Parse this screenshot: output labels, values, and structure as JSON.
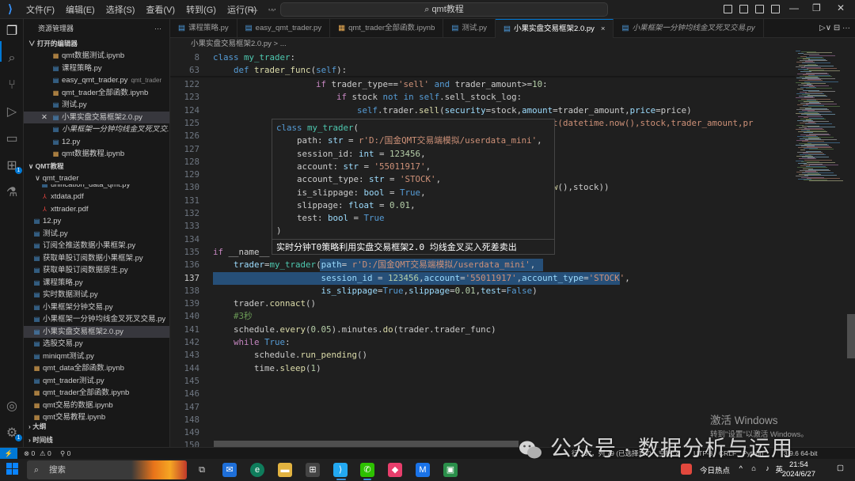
{
  "app": {
    "title": "qmt教程",
    "menu": [
      "文件(F)",
      "编辑(E)",
      "选择(S)",
      "查看(V)",
      "转到(G)",
      "运行(R)"
    ],
    "more": "···"
  },
  "sidebar": {
    "title": "资源管理器",
    "title_more": "···",
    "open_editors_label": "打开的编辑器",
    "open_editors": [
      {
        "name": "qmt数据测试.ipynb",
        "desc": ""
      },
      {
        "name": "课程策略.py",
        "desc": ""
      },
      {
        "name": "easy_qmt_trader.py",
        "desc": "qmt_trader"
      },
      {
        "name": "qmt_trader全部函数.ipynb",
        "desc": ""
      },
      {
        "name": "测试.py",
        "desc": ""
      },
      {
        "name": "小果实盘交易框架2.0.py",
        "desc": ""
      },
      {
        "name": "小果框架一分钟均线金叉死叉交...",
        "desc": ""
      },
      {
        "name": "12.py",
        "desc": ""
      },
      {
        "name": "qmt数据教程.ipynb",
        "desc": ""
      }
    ],
    "workspace_label": "QMT教程",
    "folder": "qmt_trader",
    "files": [
      "unification_data_qmt.py",
      "xtdata.pdf",
      "xttrader.pdf",
      "12.py",
      "测试.py",
      "订阅全推送数据小果框架.py",
      "获取单股订阅数据小果框架.py",
      "获取单股订阅数据原生.py",
      "课程策略.py",
      "实时数据测试.py",
      "小果框架分钟交易.py",
      "小果框架一分钟均线金叉死叉交易.py",
      "小果实盘交易框架2.0.py",
      "选股交易.py",
      "miniqmt测试.py",
      "qmt_data全部函数.ipynb",
      "qmt_trader测试.py",
      "qmt_trader全部函数.ipynb",
      "qmt交易的数据.ipynb",
      "qmt交易教程.ipynb"
    ],
    "outline_label": "大纲",
    "timeline_label": "时间线"
  },
  "tabs": [
    {
      "label": "课程策略.py",
      "active": false
    },
    {
      "label": "easy_qmt_trader.py",
      "active": false
    },
    {
      "label": "qmt_trader全部函数.ipynb",
      "active": false
    },
    {
      "label": "测试.py",
      "active": false
    },
    {
      "label": "小果实盘交易框架2.0.py",
      "active": true,
      "close": "×"
    },
    {
      "label": "小果框架一分钟均线金叉死叉交易.py",
      "active": false
    }
  ],
  "breadcrumb": "小果实盘交易框架2.0.py > ...",
  "editor": {
    "sticky": [
      {
        "ln": "8",
        "code": "class my_trader:"
      },
      {
        "ln": "63",
        "code": "    def trader_func(self):"
      }
    ],
    "lines": [
      {
        "ln": "122",
        "code": "                    if trader_type=='sell' and trader_amount>=10:"
      },
      {
        "ln": "123",
        "code": "                        if stock not in self.sell_stock_log:"
      },
      {
        "ln": "124",
        "code": "                            self.trader.sell(security=stock,amount=trader_amount,price=price)"
      },
      {
        "ln": "125",
        "code": "                                                           '.format(datetime.now(),stock,trader_amount,pr"
      },
      {
        "ln": "126",
        "code": ""
      },
      {
        "ln": "127",
        "code": ""
      },
      {
        "ln": "128",
        "code": ""
      },
      {
        "ln": "129",
        "code": ""
      },
      {
        "ln": "130",
        "code": "                                                          etime.now(),stock))"
      },
      {
        "ln": "131",
        "code": ""
      },
      {
        "ln": "132",
        "code": "                                                          ,stock))"
      },
      {
        "ln": "133",
        "code": "            els"
      },
      {
        "ln": "134",
        "code": ""
      },
      {
        "ln": "135",
        "code": "if __name__"
      },
      {
        "ln": "136",
        "code": "    trader=my_trader(path= r'D:/国金QMT交易端模拟/userdata_mini',"
      },
      {
        "ln": "137",
        "code": "                     session_id = 123456,account='55011917',account_type='STOCK',"
      },
      {
        "ln": "138",
        "code": "                     is_slippage=True,slippage=0.01,test=False)"
      },
      {
        "ln": "139",
        "code": "    trader.connact()"
      },
      {
        "ln": "140",
        "code": "    #3秒"
      },
      {
        "ln": "141",
        "code": "    schedule.every(0.05).minutes.do(trader.trader_func)"
      },
      {
        "ln": "142",
        "code": "    while True:"
      },
      {
        "ln": "143",
        "code": "        schedule.run_pending()"
      },
      {
        "ln": "144",
        "code": "        time.sleep(1)"
      },
      {
        "ln": "145",
        "code": ""
      },
      {
        "ln": "146",
        "code": ""
      },
      {
        "ln": "147",
        "code": ""
      },
      {
        "ln": "148",
        "code": ""
      },
      {
        "ln": "149",
        "code": ""
      },
      {
        "ln": "150",
        "code": ""
      }
    ]
  },
  "hover": {
    "lines": [
      "class my_trader(",
      "    path: str = r'D:/国金QMT交易端模拟/userdata_mini',",
      "    session_id: int = 123456,",
      "    account: str = '55011917',",
      "    account_type: str = 'STOCK',",
      "    is_slippage: bool = True,",
      "    slippage: float = 0.01,",
      "    test: bool = True",
      ")"
    ],
    "doc": "实时分钟T0策略利用实盘交易框架2.0 均线金叉买入死差卖出"
  },
  "status": {
    "remote": "⚡",
    "errors": "⊗ 0",
    "warnings": "⚠ 0",
    "ports": "⚲ 0",
    "cursor": "行 137，列 79 (已选择117)",
    "spaces": "空格: 4",
    "encoding": "UTF-8",
    "eol": "CRLF",
    "lang": "Python",
    "interp": "3.9.6 64-bit"
  },
  "watermarks": {
    "win_title": "激活 Windows",
    "win_sub": "转到\"设置\"以激活 Windows。",
    "wechat": "公众号 · 数据分析与运用"
  },
  "taskbar": {
    "search": "搜索",
    "news": "今日热点",
    "lang": "英",
    "time": "21:54",
    "date": "2024/6/27"
  },
  "colors": {
    "accent": "#0078d4",
    "selection": "#264f78",
    "keyword": "#569cd6",
    "string": "#ce9178"
  }
}
